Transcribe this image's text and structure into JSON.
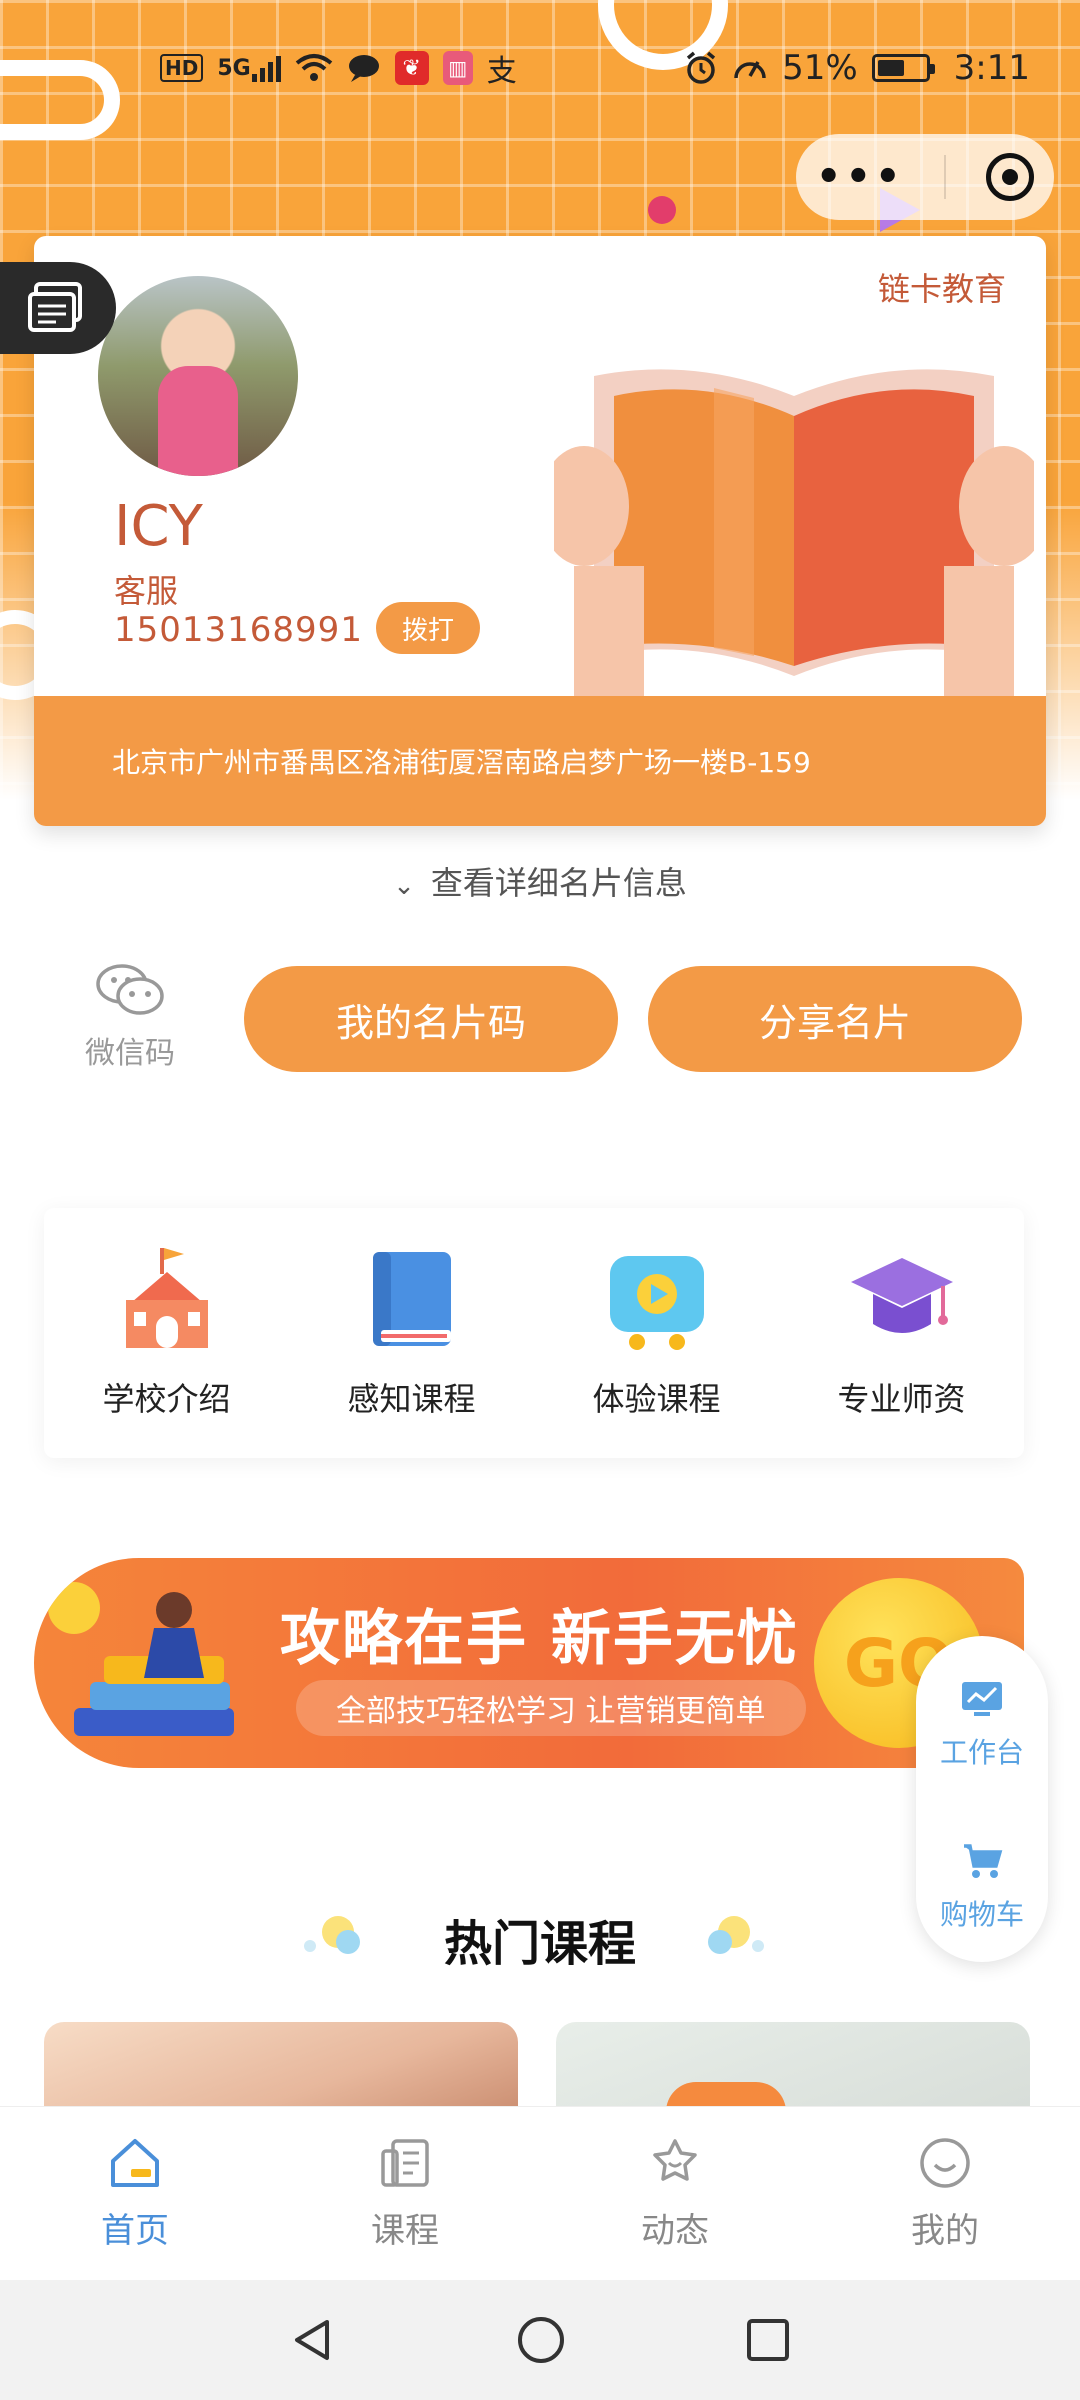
{
  "status_bar": {
    "hd": "HD",
    "signal": "5G",
    "battery_percent": "51%",
    "time": "3:11",
    "alipay_glyph": "支"
  },
  "capsule": {
    "more_label": "•••"
  },
  "card": {
    "brand": "链卡教育",
    "name": "ICY",
    "role": "客服",
    "phone": "15013168991",
    "call_label": "拨打",
    "address": "北京市广州市番禺区洛浦街厦滘南路启梦广场一楼B-159"
  },
  "view_more": {
    "label": "查看详细名片信息"
  },
  "actions": {
    "wechat_code_label": "微信码",
    "my_card_code": "我的名片码",
    "share_card": "分享名片"
  },
  "quick_menu": [
    {
      "label": "学校介绍",
      "icon": "school-icon"
    },
    {
      "label": "感知课程",
      "icon": "book-icon"
    },
    {
      "label": "体验课程",
      "icon": "video-play-icon"
    },
    {
      "label": "专业师资",
      "icon": "graduation-cap-icon"
    }
  ],
  "banner": {
    "title": "攻略在手 新手无忧",
    "subtitle": "全部技巧轻松学习 让营销更简单",
    "go": "GO"
  },
  "right_dock": {
    "workbench": "工作台",
    "cart": "购物车"
  },
  "hot_courses": {
    "title": "热门课程"
  },
  "tabs": [
    {
      "label": "首页",
      "icon": "home-icon",
      "active": true
    },
    {
      "label": "课程",
      "icon": "course-icon",
      "active": false
    },
    {
      "label": "动态",
      "icon": "star-bubble-icon",
      "active": false
    },
    {
      "label": "我的",
      "icon": "smile-icon",
      "active": false
    }
  ],
  "colors": {
    "accent_orange": "#f39a46",
    "brand_text": "#c45a38",
    "tab_active": "#4a8fd9"
  }
}
